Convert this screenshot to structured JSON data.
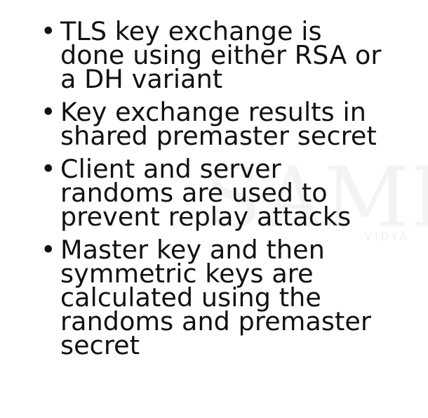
{
  "watermark": {
    "text": "SAMR",
    "subtext": "VIDYA"
  },
  "bullets": [
    {
      "lines": [
        "TLS key exchange is",
        "done using either RSA or",
        "a DH variant"
      ]
    },
    {
      "lines": [
        "Key exchange results in",
        "shared premaster secret"
      ]
    },
    {
      "lines": [
        "Client and server",
        "randoms are used to",
        "prevent replay attacks"
      ]
    },
    {
      "lines": [
        "Master key and then",
        "symmetric keys are",
        "calculated using the",
        "randoms and premaster",
        "secret"
      ]
    }
  ],
  "bullet_glyph": "•"
}
